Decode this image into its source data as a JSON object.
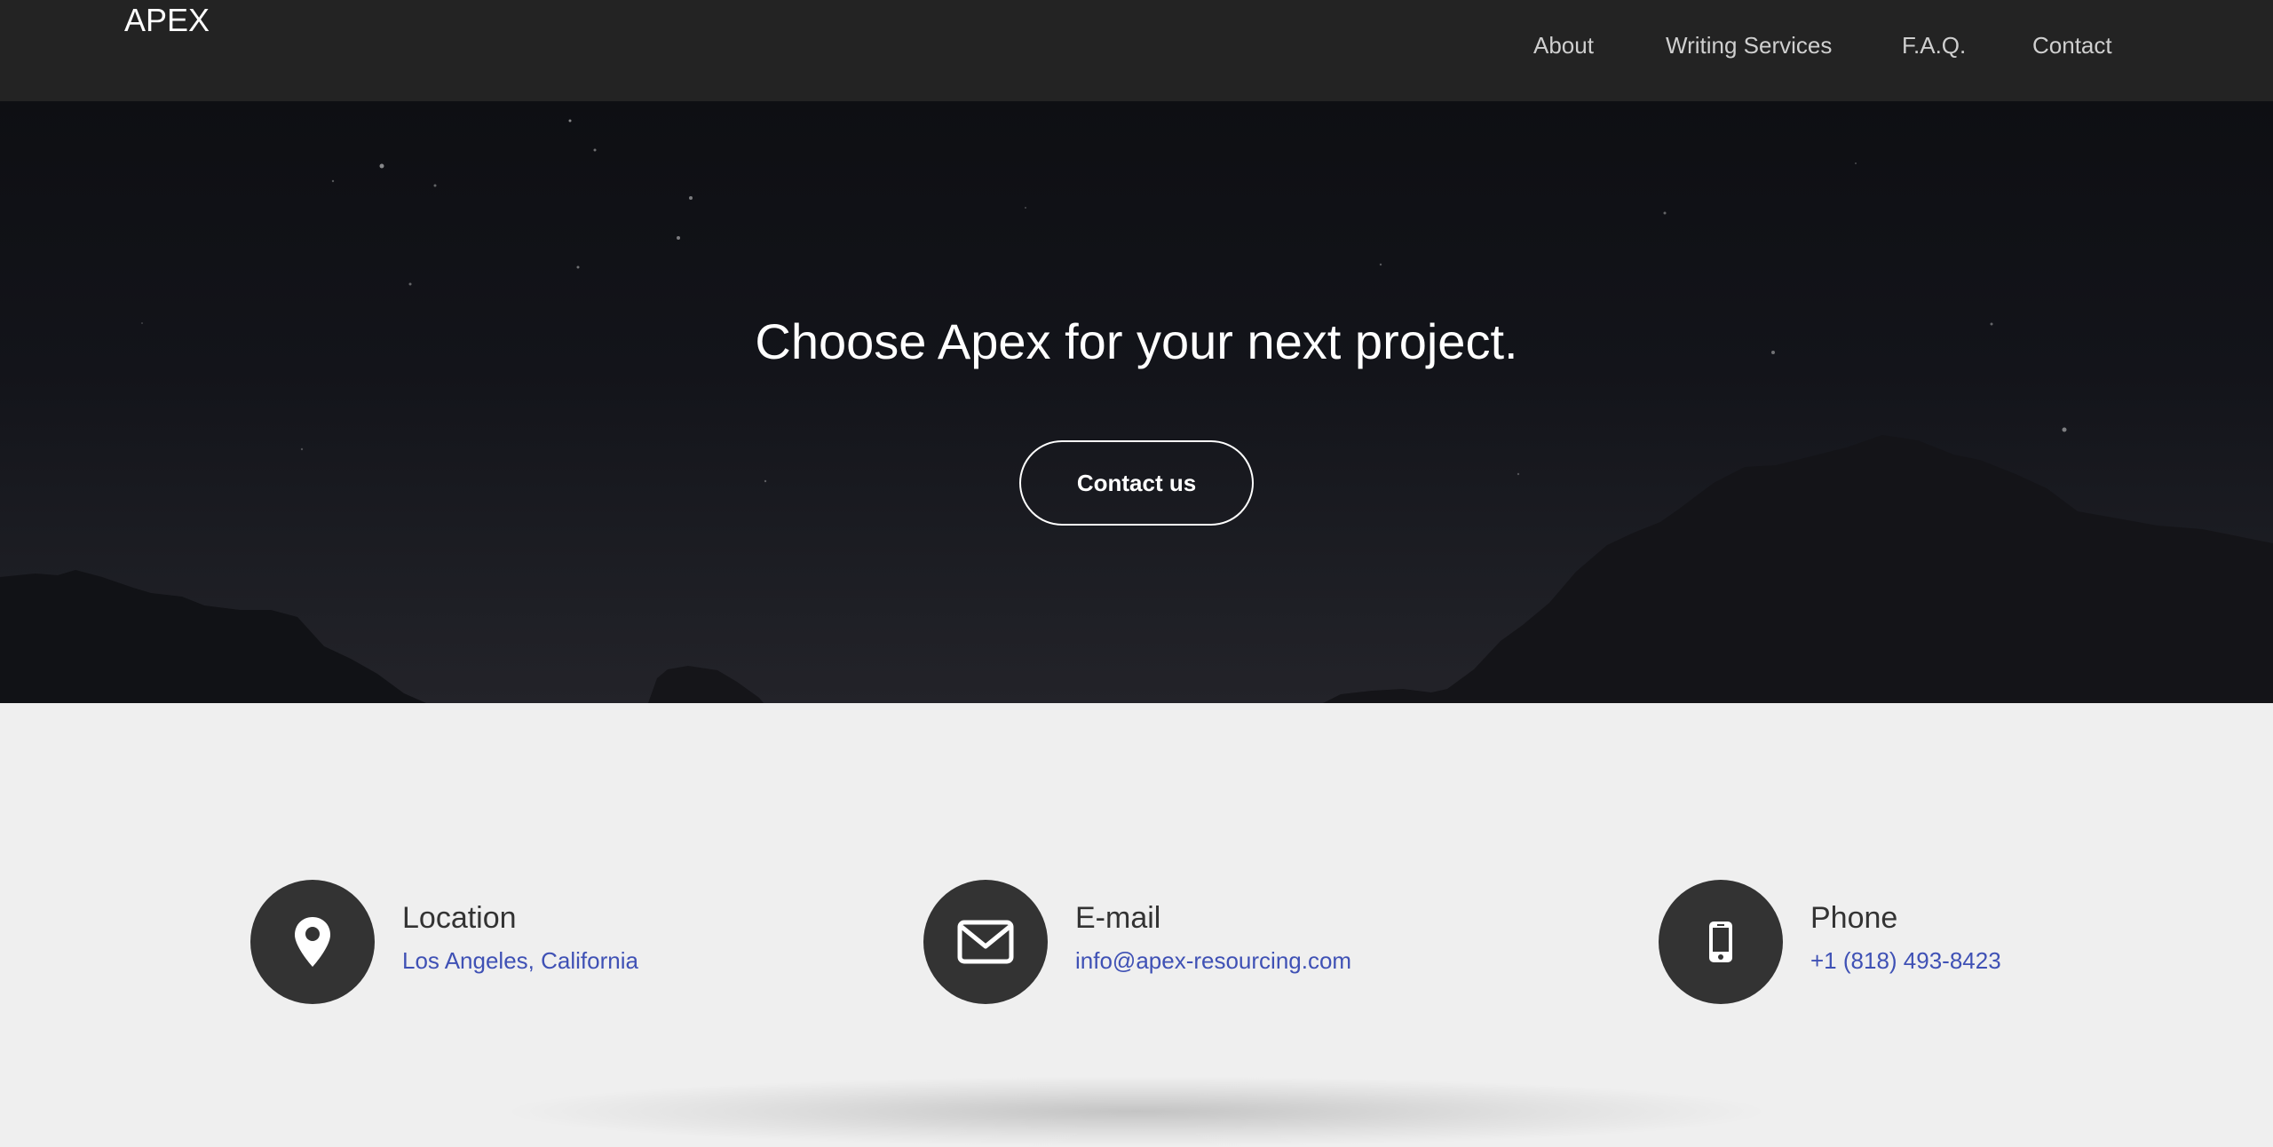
{
  "navbar": {
    "brand": "APEX",
    "links": [
      "About",
      "Writing Services",
      "F.A.Q.",
      "Contact"
    ]
  },
  "hero": {
    "title": "Choose Apex for your next project.",
    "button_label": "Contact us"
  },
  "contact_info": [
    {
      "title": "Location",
      "value": "Los Angeles, California",
      "icon": "map-pin-icon"
    },
    {
      "title": "E-mail",
      "value": "info@apex-resourcing.com",
      "icon": "envelope-icon"
    },
    {
      "title": "Phone",
      "value": "+1 (818) 493-8423",
      "icon": "mobile-phone-icon"
    }
  ],
  "colors": {
    "navbar_bg": "#232323",
    "page_bg": "#efefef",
    "icon_circle": "#333333",
    "link_accent": "#3f51b5"
  }
}
